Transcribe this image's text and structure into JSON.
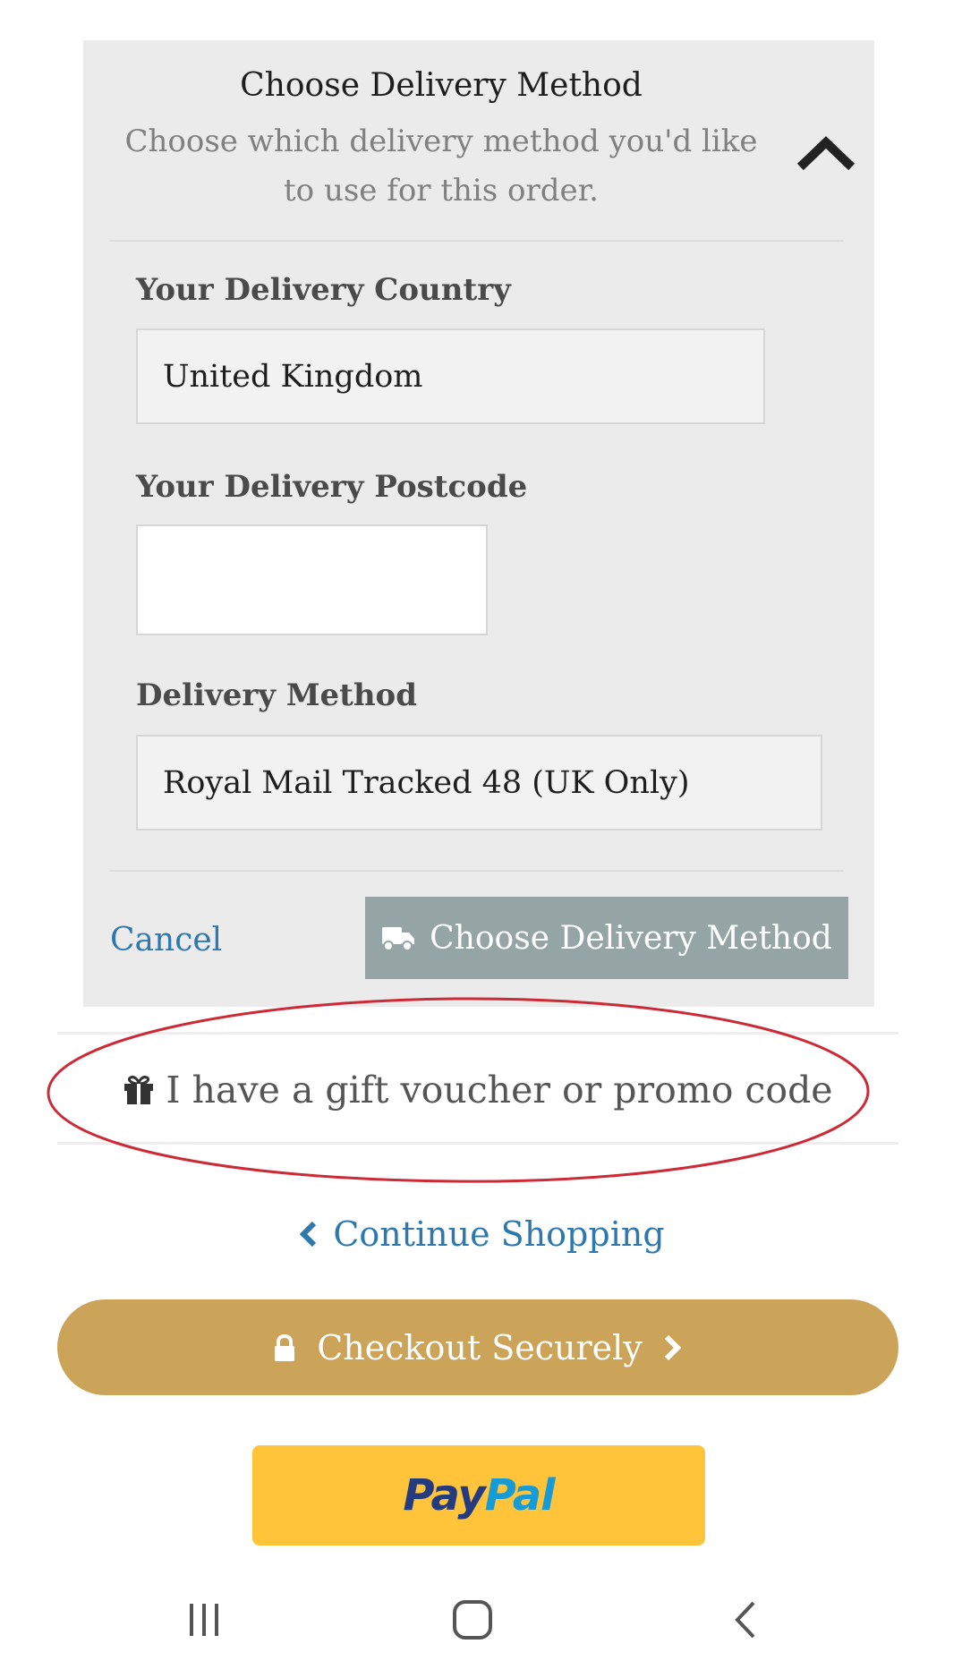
{
  "delivery_panel": {
    "title": "Choose Delivery Method",
    "description": "Choose which delivery method you'd like to use for this order.",
    "country": {
      "label": "Your Delivery Country",
      "value": "United Kingdom"
    },
    "postcode": {
      "label": "Your Delivery Postcode",
      "value": ""
    },
    "method": {
      "label": "Delivery Method",
      "value": "Royal Mail Tracked 48 (UK Only)"
    },
    "cancel_label": "Cancel",
    "choose_button_label": "Choose Delivery Method"
  },
  "voucher": {
    "label": "I have a gift voucher or promo code",
    "icon": "gift-icon"
  },
  "continue_shopping": {
    "label": "Continue Shopping",
    "icon": "chevron-left-icon"
  },
  "checkout": {
    "label": "Checkout Securely",
    "icons": [
      "lock-icon",
      "chevron-right-icon"
    ]
  },
  "paypal": {
    "logo_part1": "Pay",
    "logo_part2": "Pal"
  },
  "navbar": {
    "buttons": [
      "recent-apps-icon",
      "home-icon",
      "back-icon"
    ]
  },
  "colors": {
    "panel_bg": "#ebebeb",
    "link_blue": "#2e78b0",
    "choose_button": "#95a5a6",
    "checkout_gold": "#cba45a",
    "paypal_yellow": "#ffc43a",
    "highlight_ellipse": "#cc2a36"
  }
}
